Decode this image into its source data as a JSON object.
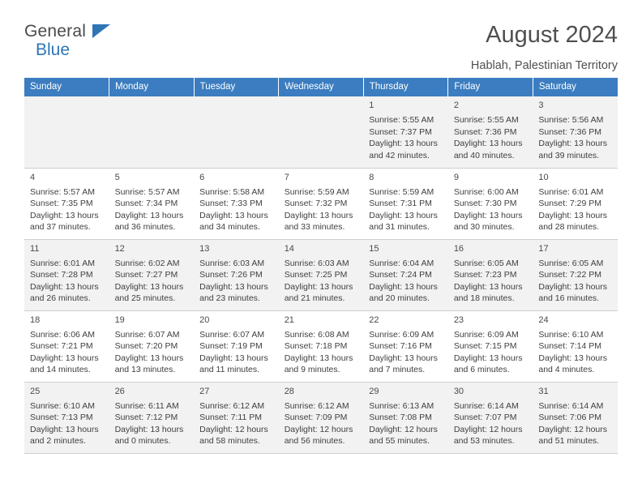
{
  "logo": {
    "word1": "General",
    "word2": "Blue",
    "flag_icon": "flag-triangle-icon",
    "accent": "#2e75b6"
  },
  "header": {
    "title": "August 2024",
    "location": "Hablah, Palestinian Territory"
  },
  "calendar": {
    "header_bg": "#3b7dc0",
    "weekdays": [
      "Sunday",
      "Monday",
      "Tuesday",
      "Wednesday",
      "Thursday",
      "Friday",
      "Saturday"
    ],
    "weeks": [
      [
        {
          "day": "",
          "lines": []
        },
        {
          "day": "",
          "lines": []
        },
        {
          "day": "",
          "lines": []
        },
        {
          "day": "",
          "lines": []
        },
        {
          "day": "1",
          "lines": [
            "Sunrise: 5:55 AM",
            "Sunset: 7:37 PM",
            "Daylight: 13 hours",
            "and 42 minutes."
          ]
        },
        {
          "day": "2",
          "lines": [
            "Sunrise: 5:55 AM",
            "Sunset: 7:36 PM",
            "Daylight: 13 hours",
            "and 40 minutes."
          ]
        },
        {
          "day": "3",
          "lines": [
            "Sunrise: 5:56 AM",
            "Sunset: 7:36 PM",
            "Daylight: 13 hours",
            "and 39 minutes."
          ]
        }
      ],
      [
        {
          "day": "4",
          "lines": [
            "Sunrise: 5:57 AM",
            "Sunset: 7:35 PM",
            "Daylight: 13 hours",
            "and 37 minutes."
          ]
        },
        {
          "day": "5",
          "lines": [
            "Sunrise: 5:57 AM",
            "Sunset: 7:34 PM",
            "Daylight: 13 hours",
            "and 36 minutes."
          ]
        },
        {
          "day": "6",
          "lines": [
            "Sunrise: 5:58 AM",
            "Sunset: 7:33 PM",
            "Daylight: 13 hours",
            "and 34 minutes."
          ]
        },
        {
          "day": "7",
          "lines": [
            "Sunrise: 5:59 AM",
            "Sunset: 7:32 PM",
            "Daylight: 13 hours",
            "and 33 minutes."
          ]
        },
        {
          "day": "8",
          "lines": [
            "Sunrise: 5:59 AM",
            "Sunset: 7:31 PM",
            "Daylight: 13 hours",
            "and 31 minutes."
          ]
        },
        {
          "day": "9",
          "lines": [
            "Sunrise: 6:00 AM",
            "Sunset: 7:30 PM",
            "Daylight: 13 hours",
            "and 30 minutes."
          ]
        },
        {
          "day": "10",
          "lines": [
            "Sunrise: 6:01 AM",
            "Sunset: 7:29 PM",
            "Daylight: 13 hours",
            "and 28 minutes."
          ]
        }
      ],
      [
        {
          "day": "11",
          "lines": [
            "Sunrise: 6:01 AM",
            "Sunset: 7:28 PM",
            "Daylight: 13 hours",
            "and 26 minutes."
          ]
        },
        {
          "day": "12",
          "lines": [
            "Sunrise: 6:02 AM",
            "Sunset: 7:27 PM",
            "Daylight: 13 hours",
            "and 25 minutes."
          ]
        },
        {
          "day": "13",
          "lines": [
            "Sunrise: 6:03 AM",
            "Sunset: 7:26 PM",
            "Daylight: 13 hours",
            "and 23 minutes."
          ]
        },
        {
          "day": "14",
          "lines": [
            "Sunrise: 6:03 AM",
            "Sunset: 7:25 PM",
            "Daylight: 13 hours",
            "and 21 minutes."
          ]
        },
        {
          "day": "15",
          "lines": [
            "Sunrise: 6:04 AM",
            "Sunset: 7:24 PM",
            "Daylight: 13 hours",
            "and 20 minutes."
          ]
        },
        {
          "day": "16",
          "lines": [
            "Sunrise: 6:05 AM",
            "Sunset: 7:23 PM",
            "Daylight: 13 hours",
            "and 18 minutes."
          ]
        },
        {
          "day": "17",
          "lines": [
            "Sunrise: 6:05 AM",
            "Sunset: 7:22 PM",
            "Daylight: 13 hours",
            "and 16 minutes."
          ]
        }
      ],
      [
        {
          "day": "18",
          "lines": [
            "Sunrise: 6:06 AM",
            "Sunset: 7:21 PM",
            "Daylight: 13 hours",
            "and 14 minutes."
          ]
        },
        {
          "day": "19",
          "lines": [
            "Sunrise: 6:07 AM",
            "Sunset: 7:20 PM",
            "Daylight: 13 hours",
            "and 13 minutes."
          ]
        },
        {
          "day": "20",
          "lines": [
            "Sunrise: 6:07 AM",
            "Sunset: 7:19 PM",
            "Daylight: 13 hours",
            "and 11 minutes."
          ]
        },
        {
          "day": "21",
          "lines": [
            "Sunrise: 6:08 AM",
            "Sunset: 7:18 PM",
            "Daylight: 13 hours",
            "and 9 minutes."
          ]
        },
        {
          "day": "22",
          "lines": [
            "Sunrise: 6:09 AM",
            "Sunset: 7:16 PM",
            "Daylight: 13 hours",
            "and 7 minutes."
          ]
        },
        {
          "day": "23",
          "lines": [
            "Sunrise: 6:09 AM",
            "Sunset: 7:15 PM",
            "Daylight: 13 hours",
            "and 6 minutes."
          ]
        },
        {
          "day": "24",
          "lines": [
            "Sunrise: 6:10 AM",
            "Sunset: 7:14 PM",
            "Daylight: 13 hours",
            "and 4 minutes."
          ]
        }
      ],
      [
        {
          "day": "25",
          "lines": [
            "Sunrise: 6:10 AM",
            "Sunset: 7:13 PM",
            "Daylight: 13 hours",
            "and 2 minutes."
          ]
        },
        {
          "day": "26",
          "lines": [
            "Sunrise: 6:11 AM",
            "Sunset: 7:12 PM",
            "Daylight: 13 hours",
            "and 0 minutes."
          ]
        },
        {
          "day": "27",
          "lines": [
            "Sunrise: 6:12 AM",
            "Sunset: 7:11 PM",
            "Daylight: 12 hours",
            "and 58 minutes."
          ]
        },
        {
          "day": "28",
          "lines": [
            "Sunrise: 6:12 AM",
            "Sunset: 7:09 PM",
            "Daylight: 12 hours",
            "and 56 minutes."
          ]
        },
        {
          "day": "29",
          "lines": [
            "Sunrise: 6:13 AM",
            "Sunset: 7:08 PM",
            "Daylight: 12 hours",
            "and 55 minutes."
          ]
        },
        {
          "day": "30",
          "lines": [
            "Sunrise: 6:14 AM",
            "Sunset: 7:07 PM",
            "Daylight: 12 hours",
            "and 53 minutes."
          ]
        },
        {
          "day": "31",
          "lines": [
            "Sunrise: 6:14 AM",
            "Sunset: 7:06 PM",
            "Daylight: 12 hours",
            "and 51 minutes."
          ]
        }
      ]
    ]
  }
}
